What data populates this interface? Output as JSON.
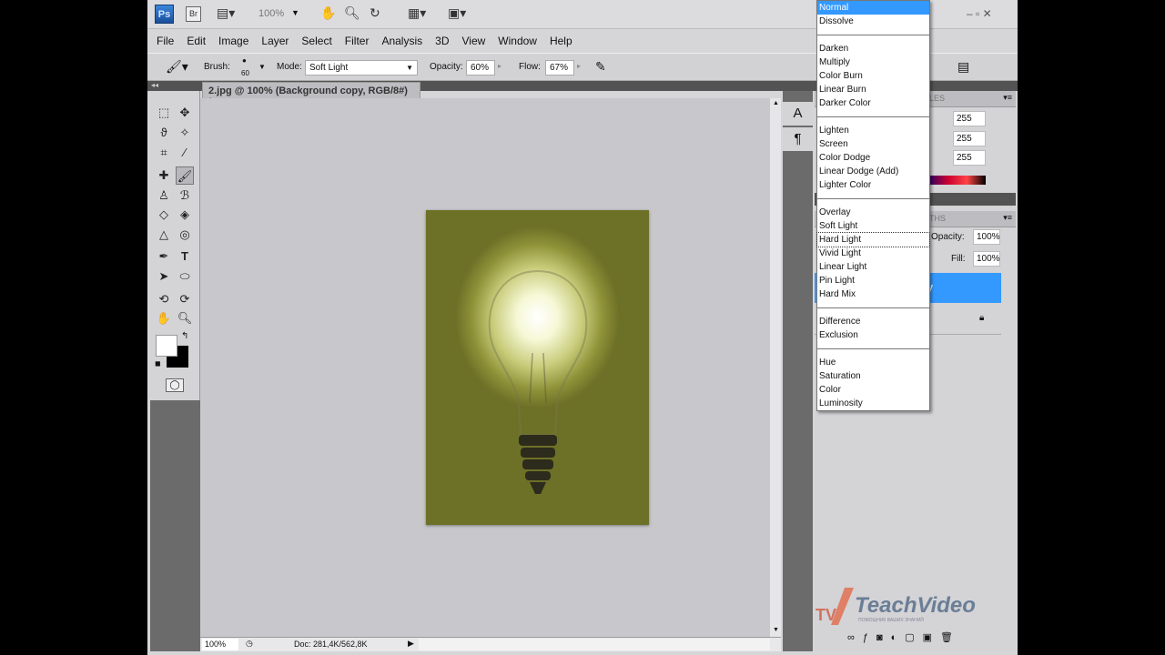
{
  "appbar": {
    "ps": "Ps",
    "br": "Br",
    "zoom": "100%",
    "icons": [
      "screen-mode-icon",
      "hand-icon",
      "zoom-icon",
      "rotate-view-icon",
      "arrange-icon",
      "screen-icon"
    ]
  },
  "menu": [
    "File",
    "Edit",
    "Image",
    "Layer",
    "Select",
    "Filter",
    "Analysis",
    "3D",
    "View",
    "Window",
    "Help"
  ],
  "options": {
    "brush_label": "Brush:",
    "brush_size": "60",
    "mode_label": "Mode:",
    "mode_value": "Soft Light",
    "opacity_label": "Opacity:",
    "opacity_value": "60%",
    "flow_label": "Flow:",
    "flow_value": "67%"
  },
  "document": {
    "tab_title": "2.jpg @ 100% (Background copy, RGB/8#) *",
    "close": "×"
  },
  "status": {
    "zoom": "100%",
    "doc": "Doc: 281,4K/562,8K"
  },
  "panels": {
    "styles_tab": "LES",
    "paths_tab": "THS",
    "rgb_values": [
      "255",
      "255",
      "255"
    ],
    "opacity_label": "Opacity:",
    "opacity_value": "100%",
    "fill_label": "Fill:",
    "fill_value": "100%",
    "layer_name": "y"
  },
  "dropdown": {
    "selected": "Normal",
    "hovered": "Hard Light",
    "groups": [
      [
        "Normal",
        "Dissolve"
      ],
      [
        "Darken",
        "Multiply",
        "Color Burn",
        "Linear Burn",
        "Darker Color"
      ],
      [
        "Lighten",
        "Screen",
        "Color Dodge",
        "Linear Dodge (Add)",
        "Lighter Color"
      ],
      [
        "Overlay",
        "Soft Light",
        "Hard Light",
        "Vivid Light",
        "Linear Light",
        "Pin Light",
        "Hard Mix"
      ],
      [
        "Difference",
        "Exclusion"
      ],
      [
        "Hue",
        "Saturation",
        "Color",
        "Luminosity"
      ]
    ]
  },
  "watermark": {
    "text": "TeachVideo",
    "tagline": "ПОМОЩНИК ВАШИХ ЗНАНИЙ"
  },
  "colors": {
    "accent": "#3399ff",
    "canvas": "#c8c7cb"
  }
}
